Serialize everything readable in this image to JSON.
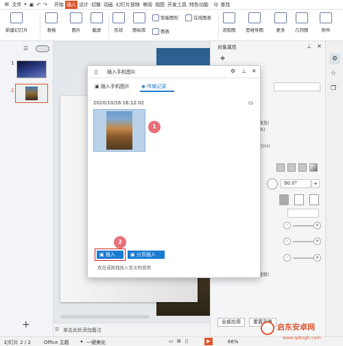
{
  "menubar": {
    "menu_icon": "≡",
    "file": "文件",
    "tabs": [
      "开始",
      "插入",
      "设计",
      "切换",
      "动画",
      "幻灯片放映",
      "审阅",
      "视图",
      "开发工具",
      "特色功能"
    ],
    "search": "查找"
  },
  "ribbon": {
    "new_slide": "新建幻灯片",
    "table": "表格",
    "picture": "图片",
    "screenshot": "截屏",
    "shape": "形状",
    "icon_lib": "图标库",
    "smart_graphic": "智能图形",
    "online_chart": "在线图表",
    "chart": "图表",
    "flowchart": "流程图",
    "mindmap": "思维导图",
    "more": "更多",
    "geometry": "几何图",
    "attachment": "附件"
  },
  "thumbs": [
    "1",
    "2"
  ],
  "dialog": {
    "title": "插入手机图片",
    "tab_insert": "插入手机图片",
    "tab_transfer": "传输记录",
    "timestamp": "2020/10/16 16:12:02",
    "insert_btn": "插入",
    "page_insert_btn": "分页插入",
    "hint": "双击或拖拽插入至文档使用"
  },
  "badges": [
    "1",
    "2"
  ],
  "rightpanel": {
    "title": "对象属性",
    "fill_partial": "填充(",
    "opt_partial": "形(H)",
    "r_partial": "(R)",
    "angle": "90.0°",
    "minus": "-",
    "plus": "+",
    "apply_all": "全部应用",
    "reset": "重置背景",
    "rotate_partial": "旋转("
  },
  "notes": "单击此处添加备注",
  "statusbar": {
    "slide_info": "幻灯片 2 / 2",
    "theme": "Office 主题",
    "beautify": "一键美化",
    "zoom": "66%"
  },
  "watermark": {
    "name": "启东安卓网",
    "url": "www.qdtzgh.com"
  },
  "colors": {
    "accent": "#d9542b",
    "blue": "#1a7bd0",
    "badge": "#e8707a",
    "highlight": "#cc2222"
  }
}
